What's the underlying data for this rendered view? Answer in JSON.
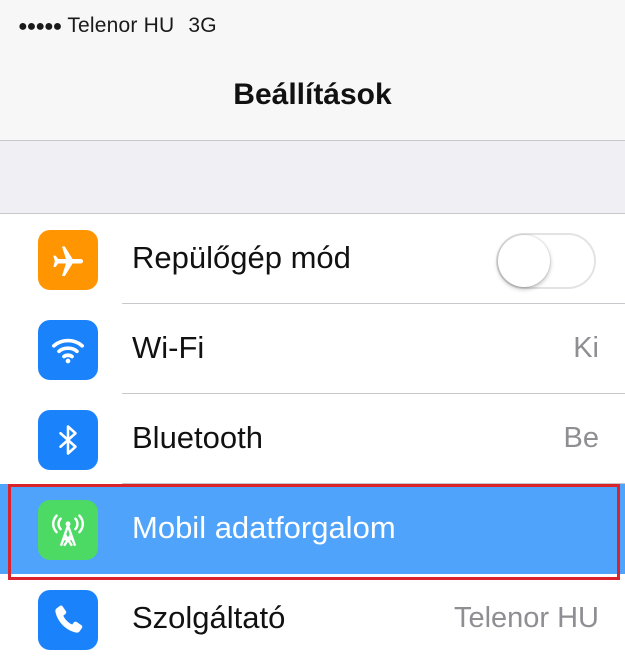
{
  "status_bar": {
    "signal_dots": "●●●●●",
    "carrier": "Telenor HU",
    "network": "3G"
  },
  "nav": {
    "title": "Beállítások"
  },
  "settings": {
    "items": [
      {
        "label": "Repülőgép mód",
        "icon": "airplane-icon",
        "icon_color": "#ff9500",
        "toggle_on": false
      },
      {
        "label": "Wi-Fi",
        "value": "Ki",
        "icon": "wifi-icon",
        "icon_color": "#1a82fb"
      },
      {
        "label": "Bluetooth",
        "value": "Be",
        "icon": "bluetooth-icon",
        "icon_color": "#1a82fb"
      },
      {
        "label": "Mobil adatforgalom",
        "icon": "cellular-antenna-icon",
        "icon_color": "#4cd964",
        "highlighted": true
      },
      {
        "label": "Szolgáltató",
        "value": "Telenor HU",
        "icon": "phone-icon",
        "icon_color": "#1a82fb"
      }
    ]
  },
  "colors": {
    "highlight_row": "#4fa3fb",
    "highlight_frame": "#d9242c"
  }
}
